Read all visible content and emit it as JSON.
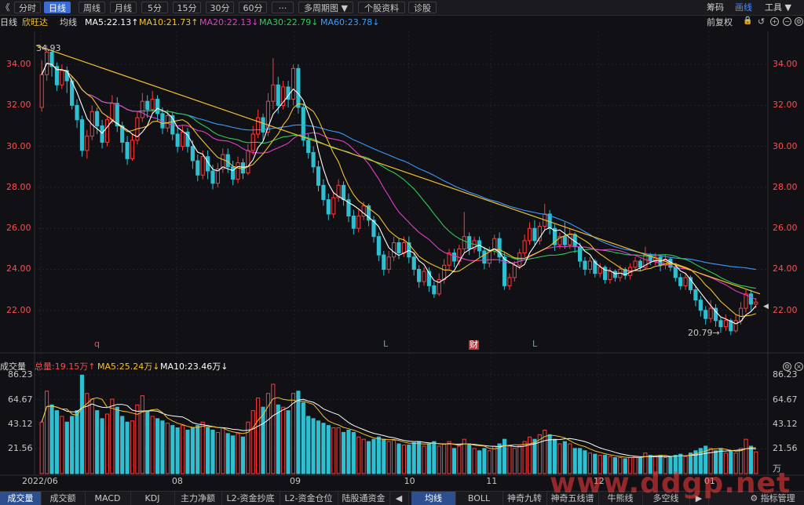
{
  "toolbar": {
    "back": "《",
    "tabs": [
      "分时",
      "日线",
      "周线",
      "月线",
      "5分",
      "15分",
      "30分",
      "60分",
      "···",
      "多周期图 ▼",
      "个股资料",
      "诊股"
    ],
    "active_tab": 1,
    "right": [
      "筹码",
      "画线",
      "工具 ▼"
    ]
  },
  "ma_bar": {
    "period": "日线",
    "stock": "欣旺达",
    "mode": "均线",
    "ma5": "MA5:22.13↑",
    "ma10": "MA10:21.73↑",
    "ma20": "MA20:22.13↓",
    "ma30": "MA30:22.79↓",
    "ma60": "MA60:23.78↓",
    "adjust": "前复权",
    "colors": {
      "ma5": "#ffffff",
      "ma10": "#f3c230",
      "ma20": "#e040c8",
      "ma30": "#2ecc55",
      "ma60": "#3a9cff"
    }
  },
  "vol_bar": {
    "title": "成交量",
    "total": "总量:19.15万↑",
    "ma5": "MA5:25.24万↓",
    "ma10": "MA10:23.46万↓"
  },
  "chart_data": {
    "type": "candlestick",
    "price_axis": {
      "ticks": [
        "34.00",
        "32.00",
        "30.00",
        "28.00",
        "26.00",
        "24.00",
        "22.00"
      ],
      "ylim": [
        20.0,
        35.0
      ]
    },
    "volume_axis": {
      "ticks": [
        "86.23",
        "64.67",
        "43.12",
        "21.56"
      ],
      "unit": "万",
      "ylim": [
        0,
        86.23
      ]
    },
    "x_ticks": [
      "2022/06",
      "08",
      "09",
      "10",
      "11",
      "12",
      "01"
    ],
    "annotations": {
      "high": "34.93",
      "low": "20.79→",
      "markers": [
        "q",
        "L",
        "财",
        "L"
      ]
    },
    "candles": [
      [
        31.9,
        33.5,
        34.2,
        31.7,
        45
      ],
      [
        33.5,
        34.6,
        34.93,
        33.2,
        72
      ],
      [
        34.6,
        33.9,
        34.8,
        33.4,
        60
      ],
      [
        33.9,
        33.0,
        34.1,
        32.7,
        55
      ],
      [
        33.0,
        33.7,
        34.0,
        32.8,
        50
      ],
      [
        33.7,
        33.2,
        33.9,
        32.6,
        45
      ],
      [
        33.2,
        32.0,
        33.4,
        31.8,
        50
      ],
      [
        32.0,
        31.3,
        32.3,
        30.9,
        55
      ],
      [
        31.3,
        29.8,
        31.5,
        29.5,
        86
      ],
      [
        29.8,
        30.5,
        30.8,
        29.4,
        70
      ],
      [
        30.5,
        31.7,
        32.0,
        30.3,
        65
      ],
      [
        31.7,
        31.0,
        31.9,
        30.6,
        55
      ],
      [
        31.0,
        30.2,
        31.3,
        29.9,
        48
      ],
      [
        30.2,
        31.3,
        31.5,
        30.0,
        52
      ],
      [
        31.3,
        32.1,
        32.5,
        31.1,
        65
      ],
      [
        32.1,
        31.0,
        32.4,
        30.7,
        58
      ],
      [
        31.0,
        30.2,
        31.2,
        29.7,
        50
      ],
      [
        30.2,
        29.4,
        30.5,
        29.1,
        45
      ],
      [
        29.4,
        30.3,
        30.6,
        29.3,
        46
      ],
      [
        30.3,
        31.4,
        31.7,
        30.1,
        60
      ],
      [
        31.4,
        32.2,
        32.6,
        31.2,
        68
      ],
      [
        32.2,
        31.8,
        32.5,
        31.4,
        55
      ],
      [
        31.8,
        32.3,
        32.7,
        31.6,
        50
      ],
      [
        32.3,
        31.6,
        32.5,
        31.2,
        48
      ],
      [
        31.6,
        30.9,
        31.9,
        30.6,
        46
      ],
      [
        30.9,
        31.5,
        31.8,
        30.7,
        44
      ],
      [
        31.5,
        30.6,
        31.7,
        30.3,
        42
      ],
      [
        30.6,
        30.0,
        30.9,
        29.7,
        40
      ],
      [
        30.0,
        30.7,
        31.0,
        29.8,
        42
      ],
      [
        30.7,
        30.0,
        30.9,
        29.7,
        38
      ],
      [
        30.0,
        29.3,
        30.3,
        28.9,
        40
      ],
      [
        29.3,
        28.6,
        29.6,
        28.3,
        42
      ],
      [
        28.6,
        29.5,
        29.8,
        28.4,
        45
      ],
      [
        29.5,
        28.8,
        29.8,
        28.4,
        40
      ],
      [
        28.8,
        28.2,
        29.1,
        27.9,
        38
      ],
      [
        28.2,
        28.9,
        29.2,
        28.0,
        36
      ],
      [
        28.9,
        29.6,
        29.9,
        28.7,
        40
      ],
      [
        29.6,
        29.0,
        29.9,
        28.7,
        35
      ],
      [
        29.0,
        28.4,
        29.3,
        28.1,
        33
      ],
      [
        28.4,
        29.2,
        29.5,
        28.2,
        35
      ],
      [
        29.2,
        28.7,
        29.4,
        28.4,
        32
      ],
      [
        28.7,
        29.8,
        30.1,
        28.6,
        45
      ],
      [
        29.8,
        30.6,
        31.0,
        29.6,
        55
      ],
      [
        30.6,
        31.4,
        31.8,
        30.4,
        66
      ],
      [
        31.4,
        30.7,
        31.6,
        30.3,
        58
      ],
      [
        30.7,
        32.2,
        32.6,
        30.5,
        70
      ],
      [
        32.2,
        33.0,
        34.3,
        31.8,
        78
      ],
      [
        33.0,
        32.0,
        33.4,
        31.6,
        60
      ],
      [
        32.0,
        32.9,
        33.2,
        31.8,
        58
      ],
      [
        32.9,
        32.3,
        33.2,
        31.9,
        55
      ],
      [
        32.3,
        33.8,
        34.0,
        32.0,
        70
      ],
      [
        33.8,
        31.9,
        34.0,
        31.6,
        72
      ],
      [
        31.9,
        30.3,
        32.1,
        30.0,
        62
      ],
      [
        30.3,
        29.7,
        30.6,
        29.4,
        50
      ],
      [
        29.7,
        29.0,
        30.0,
        28.7,
        48
      ],
      [
        29.0,
        28.1,
        29.3,
        27.8,
        46
      ],
      [
        28.1,
        27.4,
        28.4,
        27.1,
        44
      ],
      [
        27.4,
        26.7,
        27.7,
        26.4,
        42
      ],
      [
        26.7,
        27.5,
        27.8,
        26.5,
        40
      ],
      [
        27.5,
        28.1,
        28.4,
        27.3,
        40
      ],
      [
        28.1,
        27.4,
        28.3,
        27.1,
        36
      ],
      [
        27.4,
        26.6,
        27.7,
        26.3,
        38
      ],
      [
        26.6,
        26.0,
        26.9,
        25.7,
        36
      ],
      [
        26.0,
        26.6,
        26.9,
        25.8,
        32
      ],
      [
        26.6,
        27.1,
        27.3,
        26.4,
        30
      ],
      [
        27.1,
        26.4,
        27.2,
        26.1,
        28
      ],
      [
        26.4,
        25.6,
        26.6,
        25.3,
        30
      ],
      [
        25.6,
        24.7,
        25.8,
        24.4,
        32
      ],
      [
        24.7,
        24.0,
        24.9,
        23.7,
        30
      ],
      [
        24.0,
        24.6,
        24.9,
        23.8,
        28
      ],
      [
        24.6,
        25.3,
        25.6,
        24.4,
        29
      ],
      [
        25.3,
        24.8,
        25.5,
        24.5,
        26
      ],
      [
        24.8,
        25.3,
        25.6,
        24.6,
        25
      ],
      [
        25.3,
        24.6,
        25.6,
        24.3,
        25
      ],
      [
        24.6,
        24.0,
        24.8,
        23.7,
        27
      ],
      [
        24.0,
        23.4,
        24.2,
        23.1,
        28
      ],
      [
        23.4,
        23.9,
        24.1,
        23.2,
        24
      ],
      [
        23.9,
        23.2,
        24.1,
        22.9,
        26
      ],
      [
        23.2,
        22.8,
        23.4,
        22.6,
        28
      ],
      [
        22.8,
        23.5,
        23.8,
        22.7,
        24
      ],
      [
        23.5,
        24.2,
        24.5,
        23.3,
        26
      ],
      [
        24.2,
        24.8,
        25.0,
        24.0,
        28
      ],
      [
        24.8,
        24.4,
        25.0,
        24.1,
        22
      ],
      [
        24.4,
        25.0,
        25.2,
        24.2,
        24
      ],
      [
        25.0,
        25.6,
        26.8,
        24.8,
        30
      ],
      [
        25.6,
        25.0,
        25.8,
        24.7,
        26
      ],
      [
        25.0,
        25.4,
        25.6,
        24.8,
        22
      ],
      [
        25.4,
        24.9,
        25.6,
        24.6,
        20
      ],
      [
        24.9,
        24.3,
        25.1,
        24.0,
        22
      ],
      [
        24.3,
        24.9,
        25.1,
        24.1,
        20
      ],
      [
        24.9,
        25.5,
        25.7,
        24.7,
        24
      ],
      [
        25.5,
        24.6,
        25.8,
        24.3,
        26
      ],
      [
        24.6,
        23.2,
        24.8,
        23.0,
        30
      ],
      [
        23.2,
        23.6,
        23.8,
        23.0,
        24
      ],
      [
        23.6,
        24.2,
        24.4,
        23.4,
        22
      ],
      [
        24.2,
        24.8,
        25.0,
        24.0,
        24
      ],
      [
        24.8,
        25.4,
        25.7,
        24.6,
        28
      ],
      [
        25.4,
        26.0,
        26.3,
        25.2,
        32
      ],
      [
        26.0,
        25.4,
        26.4,
        25.2,
        30
      ],
      [
        25.4,
        26.1,
        26.3,
        25.2,
        34
      ],
      [
        26.1,
        26.7,
        27.2,
        25.9,
        38
      ],
      [
        26.7,
        26.0,
        26.9,
        25.7,
        34
      ],
      [
        26.0,
        25.2,
        26.2,
        24.9,
        30
      ],
      [
        25.2,
        25.6,
        25.8,
        25.0,
        26
      ],
      [
        25.6,
        25.2,
        26.3,
        25.0,
        28
      ],
      [
        25.2,
        25.7,
        26.0,
        25.0,
        26
      ],
      [
        25.7,
        25.1,
        25.8,
        24.8,
        22
      ],
      [
        25.1,
        24.4,
        25.3,
        24.1,
        22
      ],
      [
        24.4,
        24.0,
        24.6,
        23.7,
        20
      ],
      [
        24.0,
        24.4,
        24.6,
        23.8,
        18
      ],
      [
        24.4,
        23.8,
        24.5,
        23.6,
        17
      ],
      [
        23.8,
        24.1,
        24.3,
        23.6,
        16
      ],
      [
        24.1,
        23.5,
        24.2,
        23.3,
        16
      ],
      [
        23.5,
        23.9,
        24.1,
        23.3,
        15
      ],
      [
        23.9,
        23.6,
        24.0,
        23.4,
        14
      ],
      [
        23.6,
        24.0,
        24.2,
        23.4,
        14
      ],
      [
        24.0,
        23.7,
        24.1,
        23.5,
        13
      ],
      [
        23.7,
        24.1,
        24.3,
        23.5,
        14
      ],
      [
        24.1,
        24.4,
        24.6,
        23.9,
        15
      ],
      [
        24.4,
        24.1,
        24.5,
        23.9,
        14
      ],
      [
        24.1,
        24.7,
        25.1,
        24.0,
        18
      ],
      [
        24.7,
        24.4,
        24.8,
        24.2,
        16
      ],
      [
        24.4,
        24.6,
        24.8,
        24.2,
        15
      ],
      [
        24.6,
        24.2,
        24.7,
        23.9,
        16
      ],
      [
        24.2,
        24.5,
        24.7,
        24.0,
        14
      ],
      [
        24.5,
        24.1,
        24.6,
        23.9,
        15
      ],
      [
        24.1,
        23.6,
        24.3,
        23.4,
        16
      ],
      [
        23.6,
        23.2,
        23.8,
        23.0,
        17
      ],
      [
        23.2,
        23.6,
        23.8,
        23.0,
        15
      ],
      [
        23.6,
        23.0,
        23.7,
        22.8,
        18
      ],
      [
        23.0,
        22.5,
        23.2,
        22.2,
        20
      ],
      [
        22.5,
        22.0,
        22.7,
        21.7,
        22
      ],
      [
        22.0,
        21.6,
        22.2,
        21.3,
        24
      ],
      [
        21.6,
        22.1,
        22.5,
        21.4,
        22
      ],
      [
        22.1,
        21.5,
        22.3,
        21.2,
        20
      ],
      [
        21.5,
        21.2,
        21.7,
        20.9,
        22
      ],
      [
        21.2,
        21.5,
        21.8,
        21.0,
        18
      ],
      [
        21.5,
        21.0,
        21.6,
        20.79,
        20
      ],
      [
        21.0,
        21.5,
        21.8,
        20.9,
        18
      ],
      [
        21.5,
        22.1,
        22.4,
        21.3,
        22
      ],
      [
        22.1,
        22.8,
        23.0,
        21.9,
        30
      ],
      [
        22.8,
        22.3,
        23.0,
        22.0,
        24
      ],
      [
        22.3,
        22.4,
        22.6,
        22.1,
        19
      ]
    ]
  }
}
